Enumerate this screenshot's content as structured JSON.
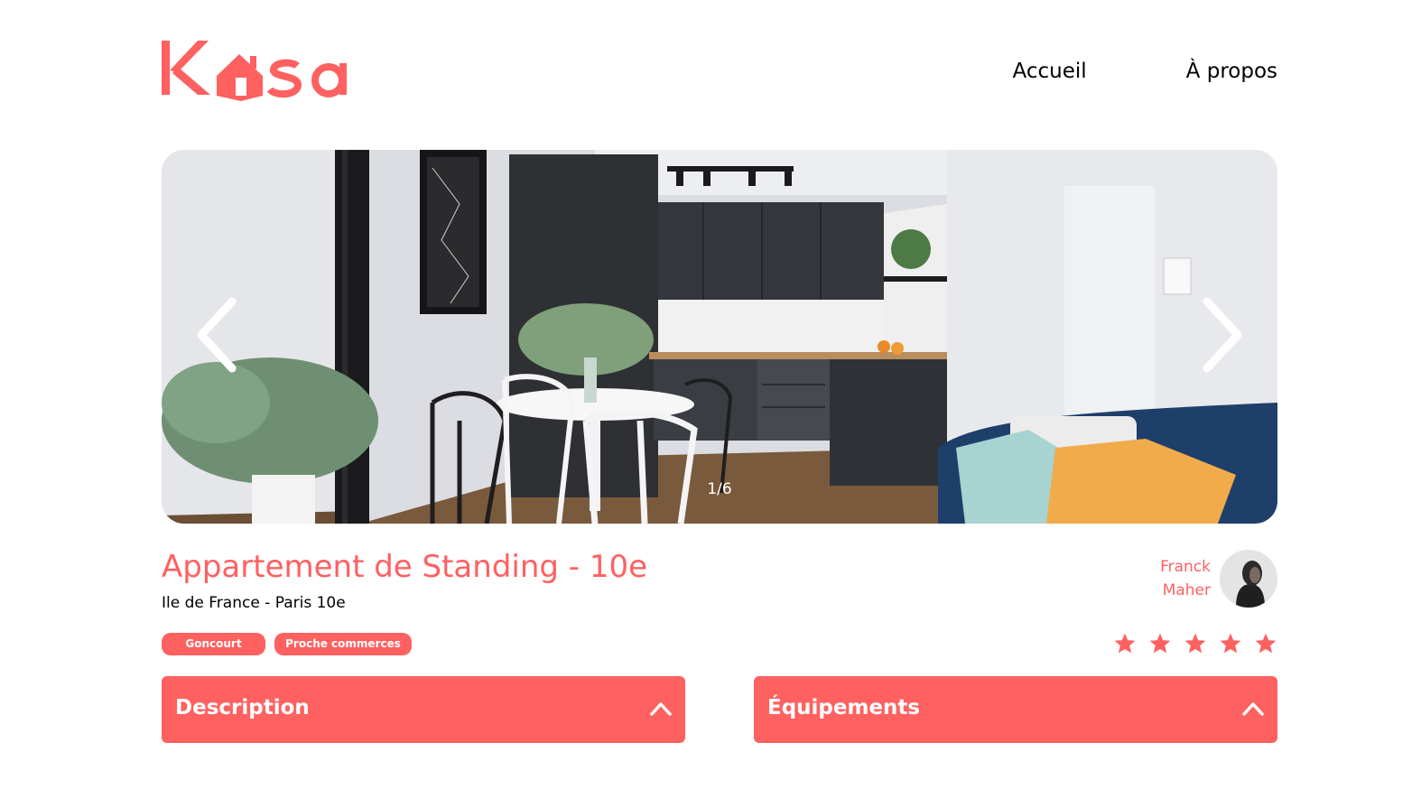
{
  "header": {
    "logo_text": "Kasa",
    "nav": [
      {
        "label": "Accueil"
      },
      {
        "label": "À propos"
      }
    ]
  },
  "gallery": {
    "counter": "1/6",
    "current": 1,
    "total": 6
  },
  "listing": {
    "title": "Appartement de Standing - 10e",
    "location": "Ile de France - Paris 10e",
    "tags": [
      "Goncourt",
      "Proche commerces"
    ]
  },
  "host": {
    "first_name": "Franck",
    "last_name": "Maher"
  },
  "rating": {
    "value": 5,
    "max": 5
  },
  "sections": [
    {
      "label": "Description"
    },
    {
      "label": "Équipements"
    }
  ],
  "colors": {
    "accent": "#FF6060",
    "text": "#000000",
    "background": "#FFFFFF"
  },
  "icons": [
    "house-icon",
    "chevron-left-icon",
    "chevron-right-icon",
    "star-icon",
    "chevron-up-icon"
  ]
}
